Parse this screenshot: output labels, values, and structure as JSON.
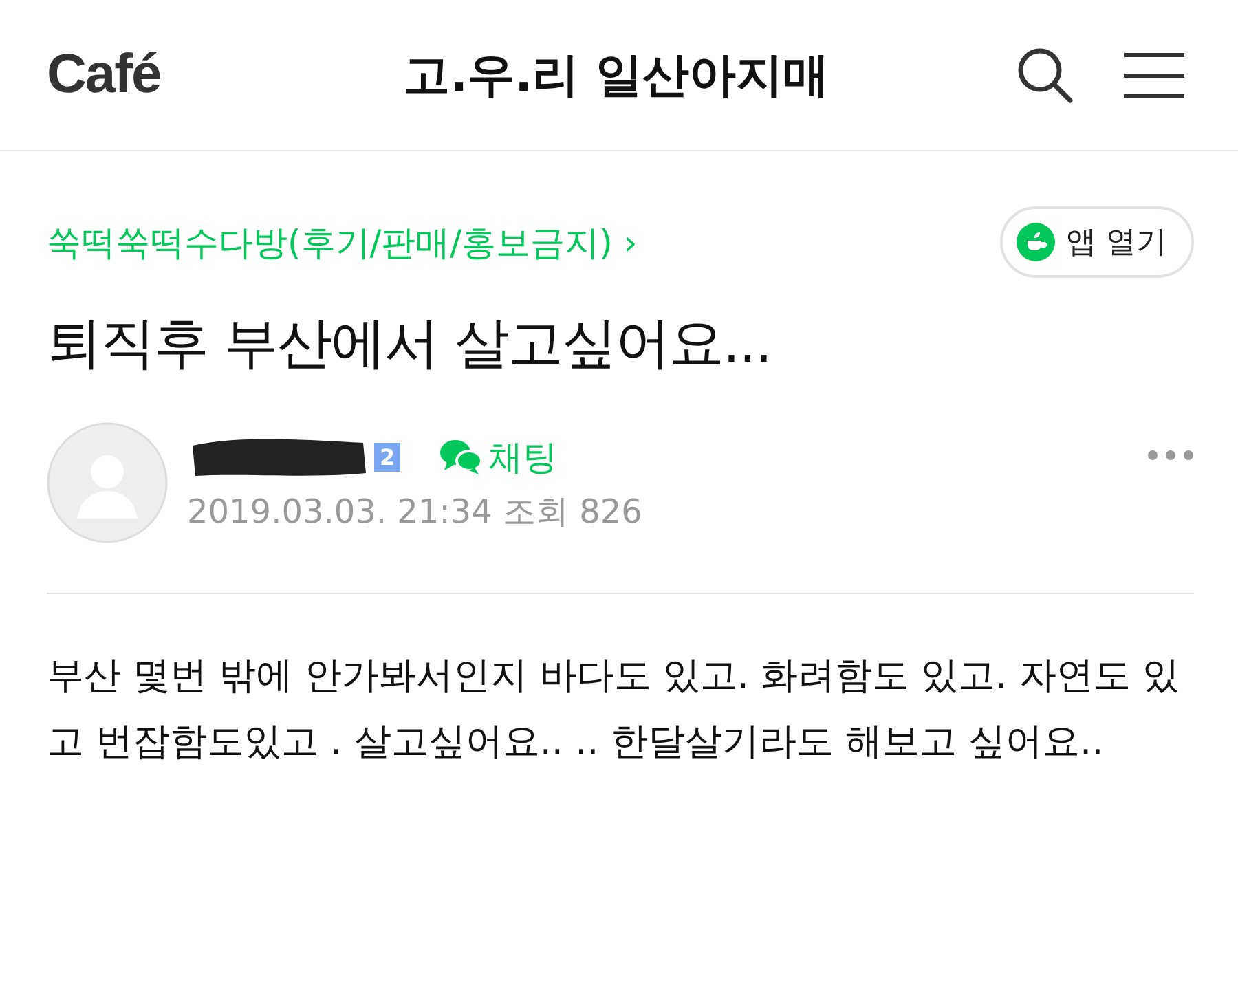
{
  "header": {
    "logo": "Café",
    "cafe_name": "고.우.리 일산아지매"
  },
  "board": {
    "name": "쑥떡쑥떡수다방(후기/판매/홍보금지)",
    "chevron": "›"
  },
  "open_app": {
    "label": "앱 열기"
  },
  "post": {
    "title": "퇴직후 부산에서 살고싶어요...",
    "author": {
      "level": "2",
      "chat": "채팅",
      "date": "2019.03.03. 21:34",
      "views_label": "조회",
      "views": "826"
    },
    "body": "부산 몇번 밖에 안가봐서인지 바다도 있고. 화려함도 있고. 자연도 있고 번잡함도있고 . 살고싶어요.. .. 한달살기라도 해보고 싶어요.."
  }
}
